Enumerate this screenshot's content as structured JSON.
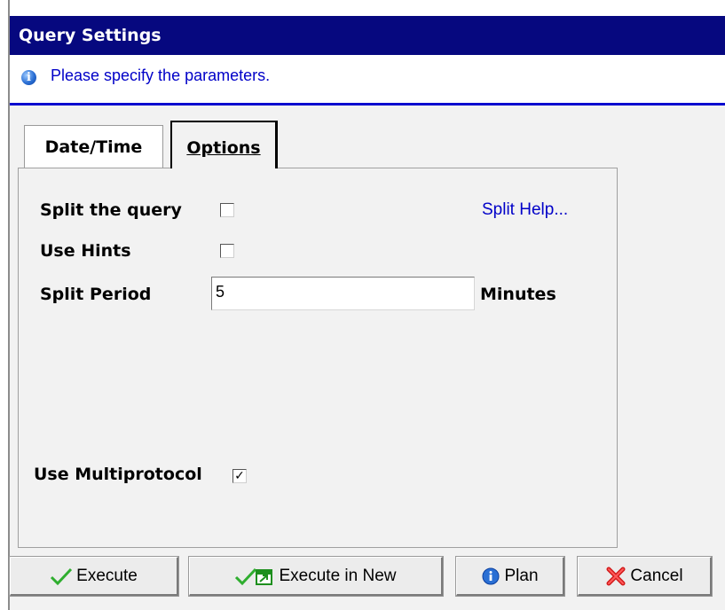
{
  "window": {
    "title": "Query Settings"
  },
  "info": {
    "message": "Please specify the parameters."
  },
  "tabs": [
    {
      "label": "Date/Time",
      "active": false
    },
    {
      "label": "Options",
      "active": true
    }
  ],
  "options": {
    "split_query": {
      "label": "Split the query",
      "checked": false
    },
    "use_hints": {
      "label": "Use Hints",
      "checked": false
    },
    "split_help_link": "Split Help...",
    "split_period": {
      "label": "Split Period",
      "value": "5",
      "unit": "Minutes"
    },
    "use_multiprotocol": {
      "label": "Use Multiprotocol",
      "checked": true,
      "mark": "✓"
    }
  },
  "buttons": {
    "execute": "Execute",
    "execute_new": "Execute in New",
    "plan": "Plan",
    "cancel": "Cancel"
  },
  "colors": {
    "title_bar": "#06087f",
    "accent_blue": "#0a0acf",
    "link": "#0000c8",
    "panel_bg": "#f2f2f2"
  },
  "icons": {
    "info": "info-icon",
    "execute": "green-check-icon",
    "execute_new": "check-new-window-icon",
    "plan": "info-icon",
    "cancel": "red-x-icon"
  }
}
